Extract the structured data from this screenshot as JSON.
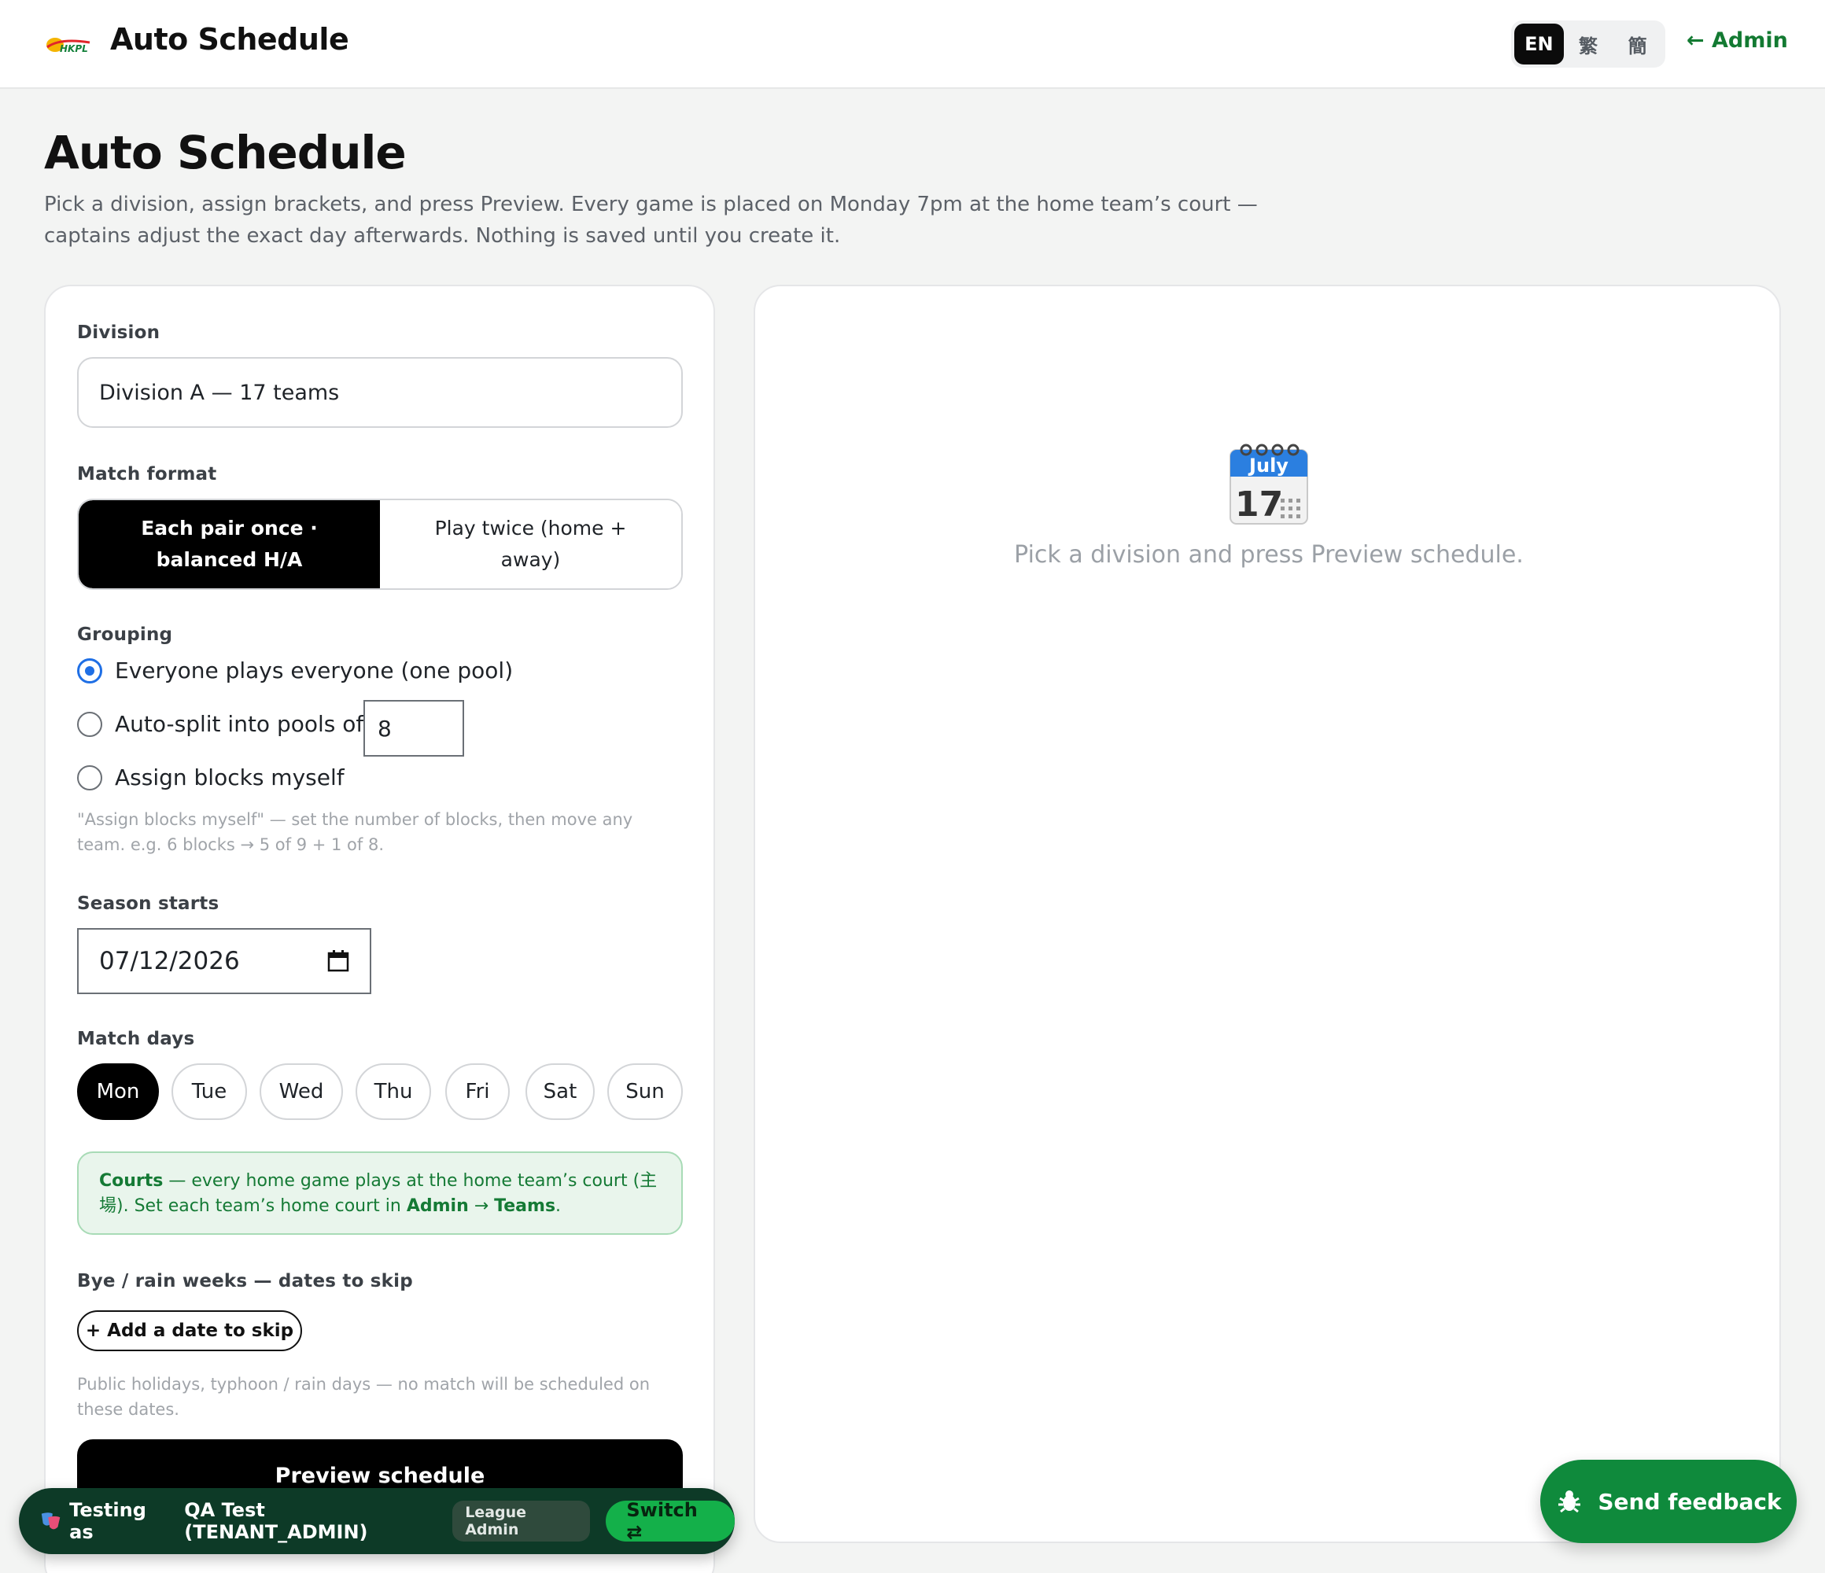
{
  "header": {
    "logo_text": "HKPL",
    "title": "Auto Schedule",
    "languages": [
      "EN",
      "繁",
      "簡"
    ],
    "active_language": "EN",
    "admin_link": "← Admin"
  },
  "page": {
    "title": "Auto Schedule",
    "description": "Pick a division, assign brackets, and press Preview. Every game is placed on Monday 7pm at the home team’s court — captains adjust the exact day afterwards. Nothing is saved until you create it."
  },
  "form": {
    "division_label": "Division",
    "division_value": "Division A — 17 teams",
    "match_format_label": "Match format",
    "match_format_options": [
      "Each pair once · balanced H/A",
      "Play twice (home + away)"
    ],
    "match_format_selected": "Each pair once · balanced H/A",
    "grouping_label": "Grouping",
    "grouping_options": [
      "Everyone plays everyone (one pool)",
      "Auto-split into pools of",
      "Assign blocks myself"
    ],
    "grouping_selected": "Everyone plays everyone (one pool)",
    "pool_size": "8",
    "grouping_hint": "\"Assign blocks myself\" — set the number of blocks, then move any team. e.g. 6 blocks → 5 of 9 + 1 of 8.",
    "season_starts_label": "Season starts",
    "season_starts_value": "07/12/2026",
    "match_days_label": "Match days",
    "match_days": [
      "Mon",
      "Tue",
      "Wed",
      "Thu",
      "Fri",
      "Sat",
      "Sun"
    ],
    "match_days_selected": [
      "Mon"
    ],
    "courts_note": {
      "title": "Courts",
      "text1": " — every home game plays at the home team’s court (主場). Set each team’s home court in ",
      "admin": "Admin",
      "arrow": " → ",
      "teams": "Teams",
      "end": "."
    },
    "skip_label": "Bye / rain weeks — dates to skip",
    "skip_button": "+ Add a date to skip",
    "skip_hint": "Public holidays, typhoon / rain days — no match will be scheduled on these dates.",
    "preview_button": "Preview schedule"
  },
  "preview_panel": {
    "calendar_month": "July",
    "calendar_day": "17",
    "empty_text": "Pick a division and press Preview schedule."
  },
  "testing_bar": {
    "label": "Testing as",
    "user": "QA Test (TENANT_ADMIN)",
    "role_badge": "League Admin",
    "switch_button": "Switch ⇄"
  },
  "feedback_button": "Send feedback"
}
